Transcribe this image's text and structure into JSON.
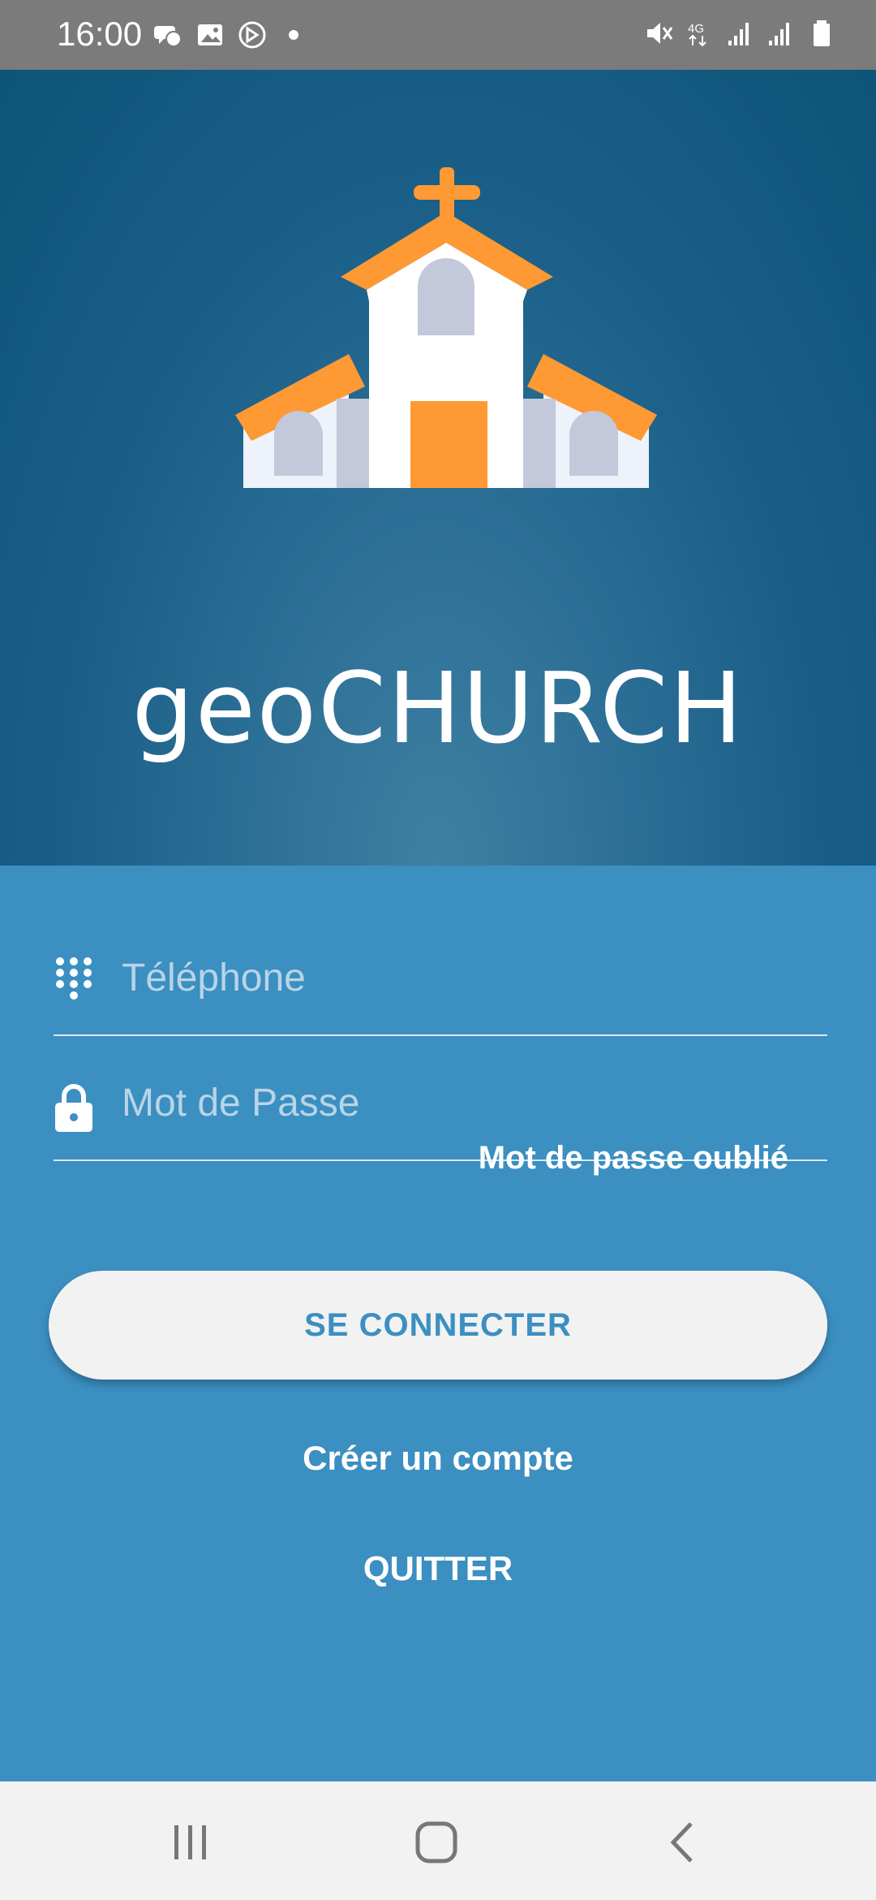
{
  "status_bar": {
    "time": "16:00",
    "left_icons": [
      "chat-icon",
      "image-icon",
      "nav-arrow-icon",
      "dot-icon"
    ],
    "right_icons": [
      "mute-icon",
      "4g-icon",
      "signal-icon",
      "signal-icon",
      "battery-icon"
    ],
    "network_label": "4G"
  },
  "hero": {
    "brand_name": "geoCHURCH",
    "logo_colors": {
      "orange": "#ff9933",
      "white": "#ffffff",
      "light": "#eef2fb",
      "gray": "#c3c8da"
    },
    "bg_color": "#0c5478"
  },
  "form": {
    "phone": {
      "placeholder": "Téléphone",
      "value": "",
      "icon": "dialpad-icon"
    },
    "password": {
      "placeholder": "Mot de Passe",
      "value": "",
      "icon": "lock-icon"
    },
    "forgot_label": "Mot de passe oublié",
    "login_label": "SE CONNECTER",
    "create_account_label": "Créer un compte",
    "quit_label": "QUITTER",
    "bg_color": "#3b8fc1",
    "button_text_color": "#3b8fc1"
  },
  "nav_bar": {
    "buttons": [
      "recent-apps-icon",
      "home-icon",
      "back-icon"
    ]
  }
}
